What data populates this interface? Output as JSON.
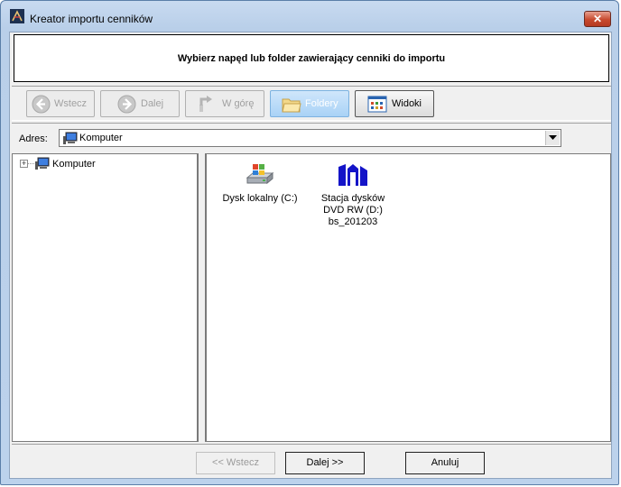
{
  "window": {
    "title": "Kreator importu cenników",
    "close_glyph": "✕"
  },
  "header": {
    "text": "Wybierz napęd lub folder zawierający cenniki do importu"
  },
  "toolbar": {
    "back": "Wstecz",
    "forward": "Dalej",
    "up": "W górę",
    "folders": "Foldery",
    "views": "Widoki"
  },
  "address": {
    "label": "Adres:",
    "value": "Komputer"
  },
  "tree": {
    "root_expander": "+",
    "root_label": "Komputer"
  },
  "items": [
    {
      "label": "Dysk lokalny (C:)",
      "icon": "local-disk-icon"
    },
    {
      "label": "Stacja dysków DVD RW (D:) bs_201203",
      "icon": "dvd-drive-icon"
    }
  ],
  "footer": {
    "back": "<< Wstecz",
    "next": "Dalej >>",
    "cancel": "Anuluj"
  },
  "colors": {
    "active_button": "#a9d2f6",
    "title_bar": "#c8daf0",
    "close_button": "#c7492e"
  }
}
